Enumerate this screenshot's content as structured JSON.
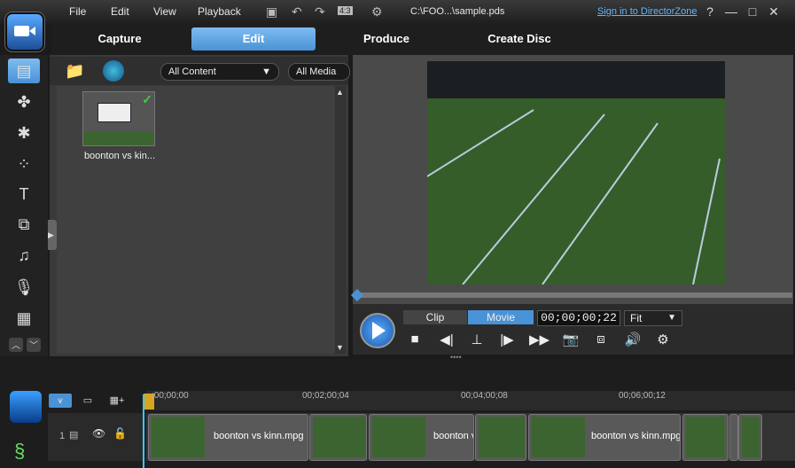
{
  "menu": {
    "file": "File",
    "edit": "Edit",
    "view": "View",
    "playback": "Playback"
  },
  "toolbar": {
    "ratio": "4:3"
  },
  "file_path": "C:\\FOO...\\sample.pds",
  "signin_link": "Sign in to DirectorZone",
  "window_buttons": {
    "help": "?",
    "minimize": "—",
    "maximize": "□",
    "close": "✕"
  },
  "modes": {
    "capture": "Capture",
    "edit": "Edit",
    "produce": "Produce",
    "create_disc": "Create Disc"
  },
  "library": {
    "filter_content": "All Content",
    "filter_media": "All Media",
    "items": [
      {
        "label": "boonton vs kin..."
      }
    ]
  },
  "preview": {
    "seg_clip": "Clip",
    "seg_movie": "Movie",
    "timecode": "00;00;00;22",
    "fit": "Fit"
  },
  "timeline": {
    "ticks": [
      ";00;00;00",
      "00;02;00;04",
      "00;04;00;08",
      "00;06;00;12"
    ],
    "track_number": "1",
    "clips": [
      {
        "label": "boonton vs kinn.mpg"
      },
      {
        "label": ""
      },
      {
        "label": "boonton v"
      },
      {
        "label": ""
      },
      {
        "label": "boonton vs kinn.mpg"
      },
      {
        "label": ""
      },
      {
        "label": ""
      }
    ]
  },
  "colors": {
    "accent": "#4a92d6",
    "link": "#5fb6ff",
    "playhead": "#33ccff"
  }
}
